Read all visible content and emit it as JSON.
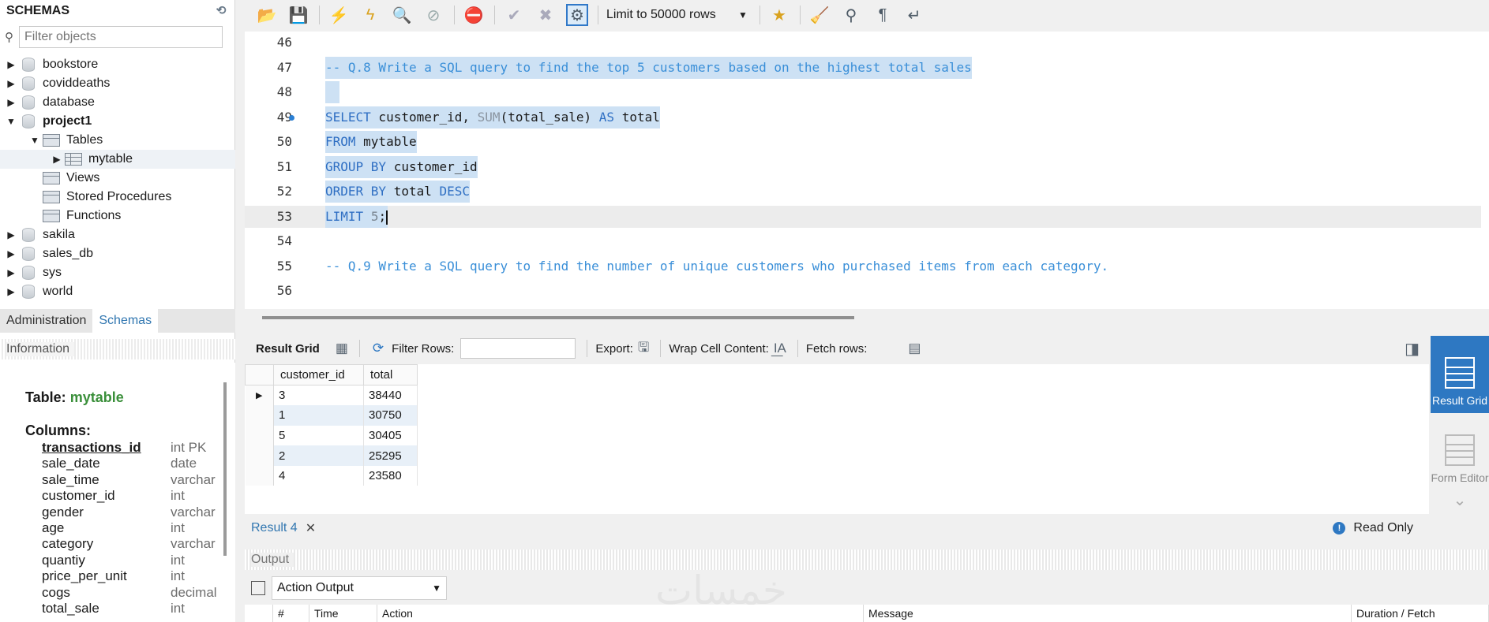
{
  "navigator": {
    "title": "SCHEMAS",
    "filter_placeholder": "Filter objects",
    "schemas": [
      {
        "name": "bookstore"
      },
      {
        "name": "coviddeaths"
      },
      {
        "name": "database"
      },
      {
        "name": "project1"
      },
      {
        "name": "sakila"
      },
      {
        "name": "sales_db"
      },
      {
        "name": "sys"
      },
      {
        "name": "world"
      }
    ],
    "project1_children": {
      "tables": "Tables",
      "table_item": "mytable",
      "views": "Views",
      "procedures": "Stored Procedures",
      "functions": "Functions"
    },
    "tabs": [
      "Administration",
      "Schemas"
    ],
    "info_title": "Information"
  },
  "info": {
    "table_label": "Table:",
    "table_name": "mytable",
    "columns_label": "Columns:",
    "columns": [
      {
        "name": "transactions_id",
        "type": "int PK"
      },
      {
        "name": "sale_date",
        "type": "date"
      },
      {
        "name": "sale_time",
        "type": "varchar"
      },
      {
        "name": "customer_id",
        "type": "int"
      },
      {
        "name": "gender",
        "type": "varchar"
      },
      {
        "name": "age",
        "type": "int"
      },
      {
        "name": "category",
        "type": "varchar"
      },
      {
        "name": "quantiy",
        "type": "int"
      },
      {
        "name": "price_per_unit",
        "type": "int"
      },
      {
        "name": "cogs",
        "type": "decimal"
      },
      {
        "name": "total_sale",
        "type": "int"
      }
    ]
  },
  "toolbar": {
    "limit_label": "Limit to 50000 rows"
  },
  "editor": {
    "lines": [
      {
        "num": "46",
        "code": ""
      },
      {
        "num": "47",
        "code": "-- Q.8 Write a SQL query to find the top 5 customers based on the highest total sales"
      },
      {
        "num": "48",
        "code": ""
      },
      {
        "num": "49",
        "code": "SELECT customer_id, SUM(total_sale) AS total"
      },
      {
        "num": "50",
        "code": "FROM mytable"
      },
      {
        "num": "51",
        "code": "GROUP BY customer_id"
      },
      {
        "num": "52",
        "code": "ORDER BY total DESC"
      },
      {
        "num": "53",
        "code": "LIMIT 5;"
      },
      {
        "num": "54",
        "code": ""
      },
      {
        "num": "55",
        "code": "-- Q.9 Write a SQL query to find the number of unique customers who purchased items from each category."
      },
      {
        "num": "56",
        "code": ""
      }
    ]
  },
  "results_toolbar": {
    "result_grid": "Result Grid",
    "filter_rows": "Filter Rows:",
    "export": "Export:",
    "wrap": "Wrap Cell Content:",
    "fetch": "Fetch rows:"
  },
  "grid": {
    "columns": [
      "customer_id",
      "total"
    ],
    "rows": [
      [
        "3",
        "38440"
      ],
      [
        "1",
        "30750"
      ],
      [
        "5",
        "30405"
      ],
      [
        "2",
        "25295"
      ],
      [
        "4",
        "23580"
      ]
    ]
  },
  "side_panel": {
    "result_grid": "Result Grid",
    "form_editor": "Form Editor"
  },
  "result_tab": {
    "label": "Result 4",
    "status": "Read Only"
  },
  "output": {
    "title": "Output",
    "selector": "Action Output",
    "columns": [
      "#",
      "Time",
      "Action",
      "Message",
      "Duration / Fetch"
    ]
  },
  "watermark": "خمسات"
}
